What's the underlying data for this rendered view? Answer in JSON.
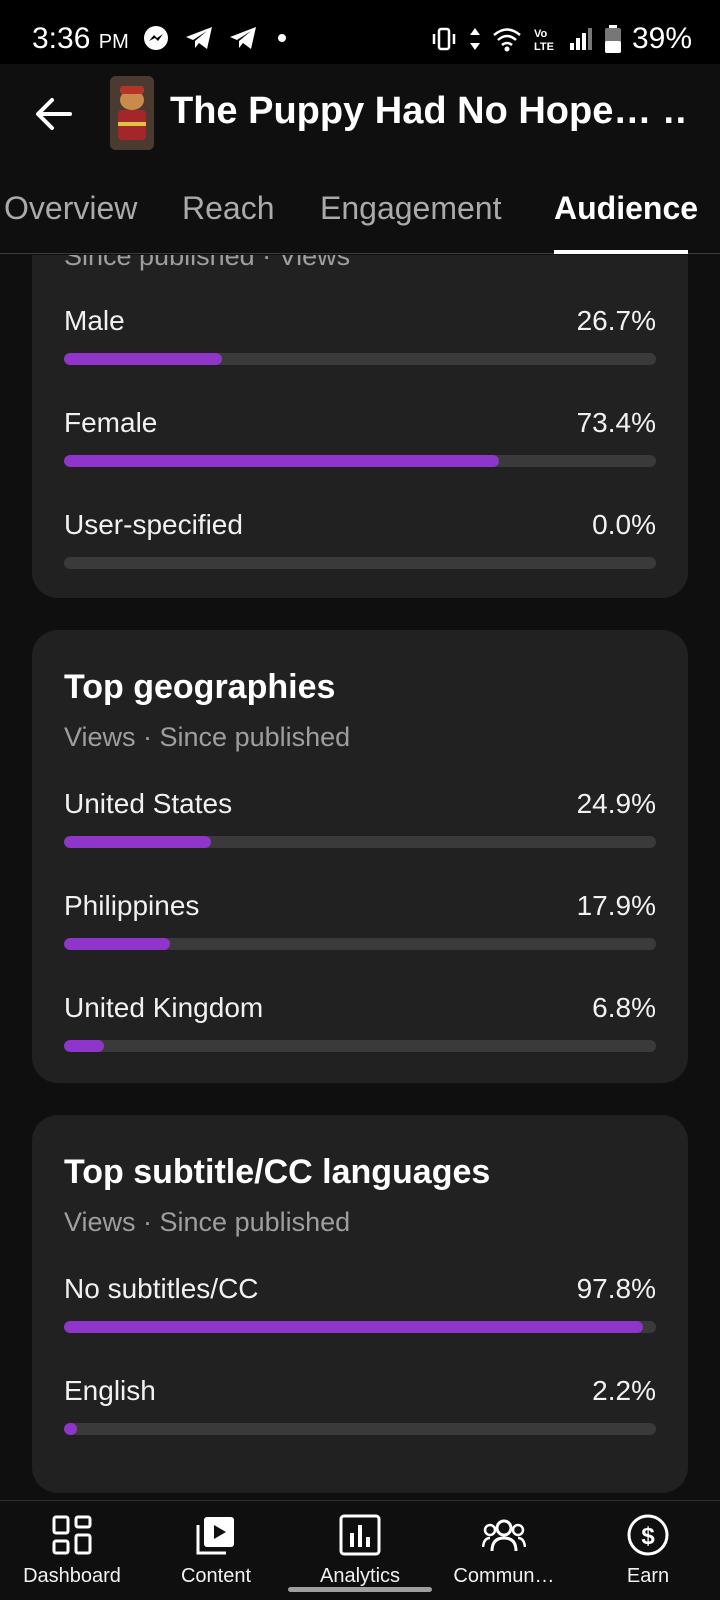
{
  "status_bar": {
    "time": "3:36",
    "ampm": "PM",
    "battery": "39%"
  },
  "header": {
    "back_icon": "arrow-left-icon",
    "title": "The Puppy Had No Hope… …"
  },
  "tabs": [
    {
      "label": "Overview",
      "active": false
    },
    {
      "label": "Reach",
      "active": false
    },
    {
      "label": "Engagement",
      "active": false
    },
    {
      "label": "Audience",
      "active": true
    }
  ],
  "gender": {
    "partial_subtitle": "Since published · Views",
    "rows": [
      {
        "label": "Male",
        "value": "26.7%",
        "pct": 26.7
      },
      {
        "label": "Female",
        "value": "73.4%",
        "pct": 73.4
      },
      {
        "label": "User-specified",
        "value": "0.0%",
        "pct": 0.0
      }
    ]
  },
  "geographies": {
    "title": "Top geographies",
    "subtitle": "Views · Since published",
    "rows": [
      {
        "label": "United States",
        "value": "24.9%",
        "pct": 24.9
      },
      {
        "label": "Philippines",
        "value": "17.9%",
        "pct": 17.9
      },
      {
        "label": "United Kingdom",
        "value": "6.8%",
        "pct": 6.8
      }
    ]
  },
  "subtitles": {
    "title": "Top subtitle/CC languages",
    "subtitle": "Views · Since published",
    "rows": [
      {
        "label": "No subtitles/CC",
        "value": "97.8%",
        "pct": 97.8
      },
      {
        "label": "English",
        "value": "2.2%",
        "pct": 2.2
      }
    ]
  },
  "bottom_nav": [
    {
      "label": "Dashboard",
      "icon": "dashboard-icon"
    },
    {
      "label": "Content",
      "icon": "content-icon"
    },
    {
      "label": "Analytics",
      "icon": "analytics-icon",
      "active": true
    },
    {
      "label": "Commun…",
      "icon": "community-icon"
    },
    {
      "label": "Earn",
      "icon": "earn-icon"
    }
  ],
  "colors": {
    "bar_fill": "#8f35c9",
    "bar_track": "#3a3a3a",
    "card": "#212121",
    "background": "#0f0f0f"
  }
}
